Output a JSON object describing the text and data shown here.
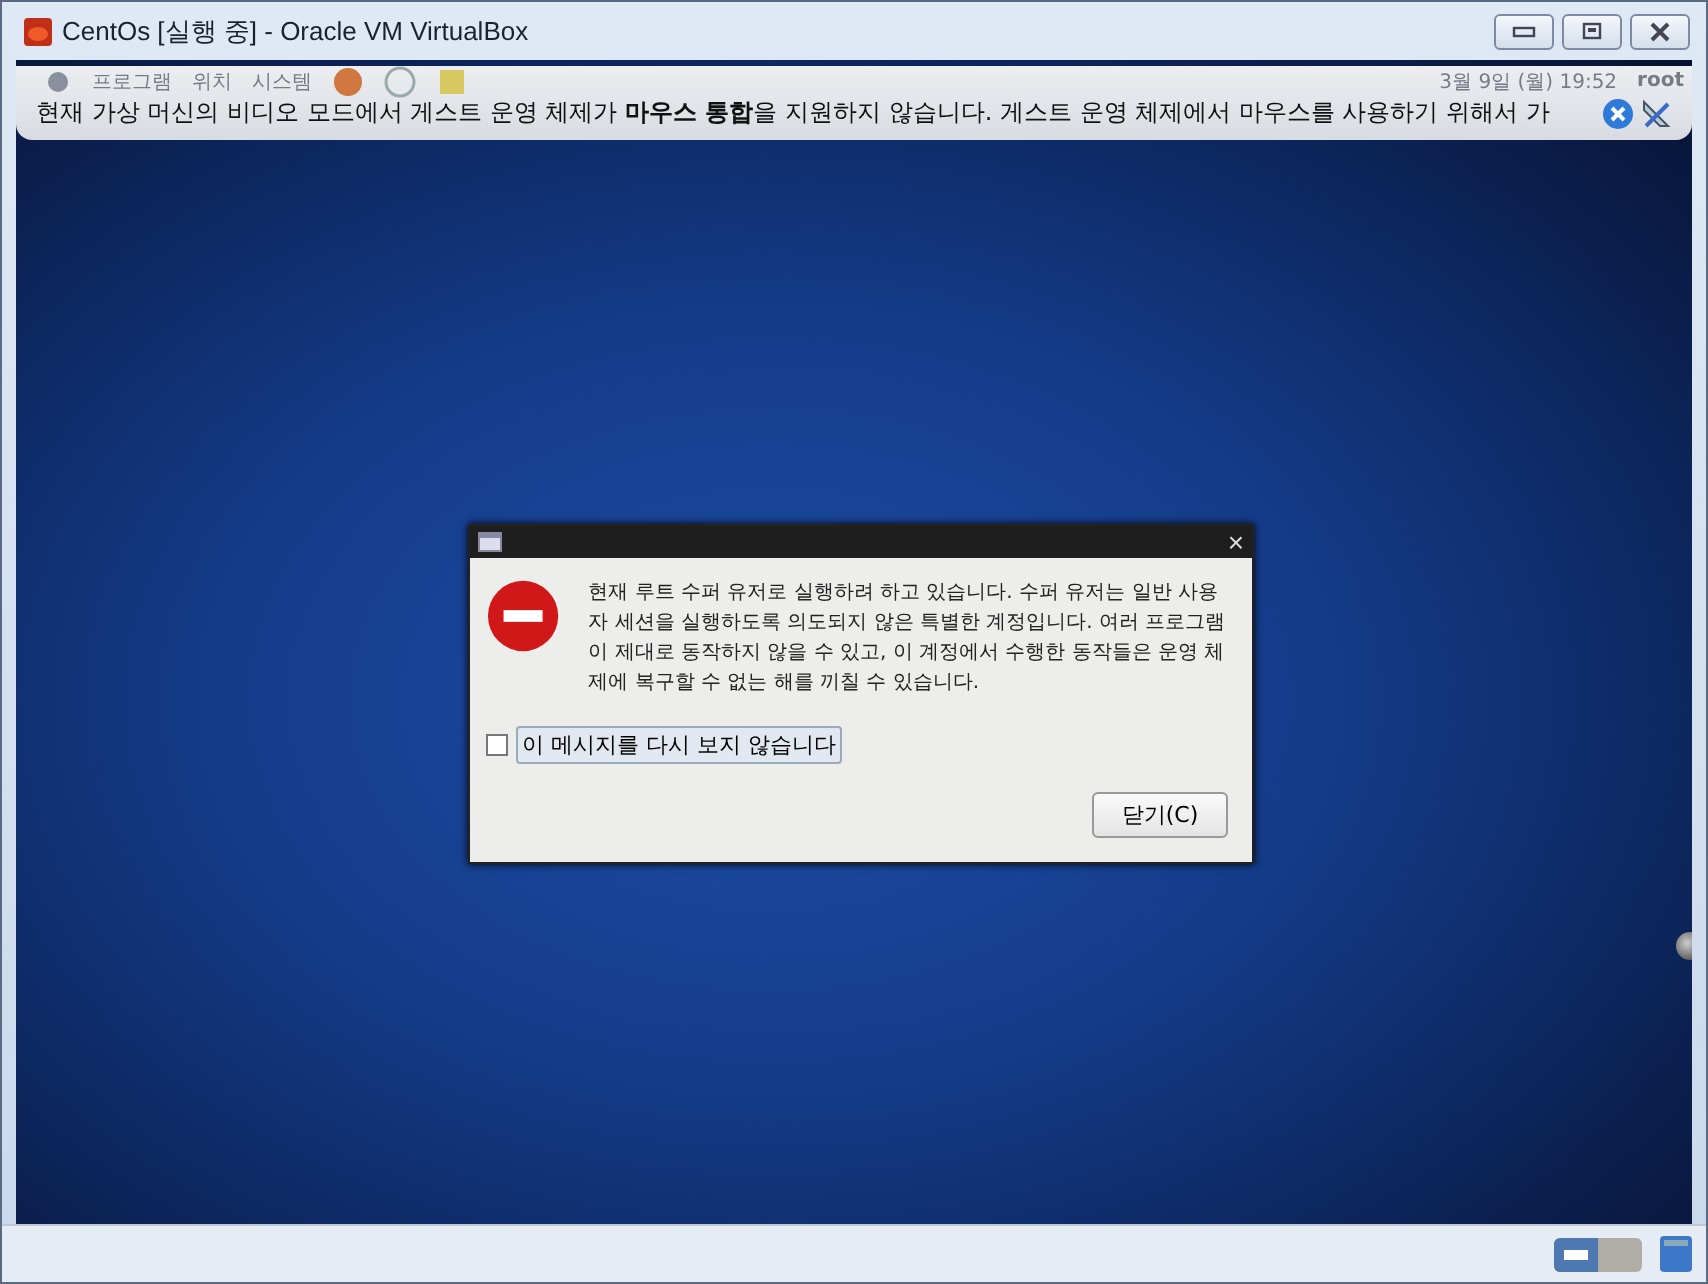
{
  "window": {
    "title": "CentOs [실행 중] - Oracle VM VirtualBox"
  },
  "guest_panel": {
    "menus": [
      "프로그램",
      "위치",
      "시스템"
    ],
    "clock": "3월  9일 (월) 19:52",
    "user": "root"
  },
  "notification": {
    "message": "현재 가상 머신의 비디오 모드에서 게스트 운영 체제가 **마우스 통합**을 지원하지 않습니다. 게스트 운영 체제에서 마우스를 사용하기 위해서 가"
  },
  "dialog": {
    "message": "현재 루트 수퍼 유저로 실행하려 하고 있습니다. 수퍼 유저는 일반 사용자 세션을 실행하도록 의도되지 않은 특별한 계정입니다. 여러 프로그램이 제대로 동작하지 않을 수 있고, 이 계정에서 수행한 동작들은 운영 체제에 복구할 수 없는 해를 끼칠 수 있습니다.",
    "checkbox": {
      "label": "이 메시지를 다시 보지 않습니다",
      "checked": false
    },
    "close_button": "닫기(C)"
  },
  "close_glyph": "×",
  "status_bar": {
    "mouse_integration": {
      "on": true
    }
  }
}
